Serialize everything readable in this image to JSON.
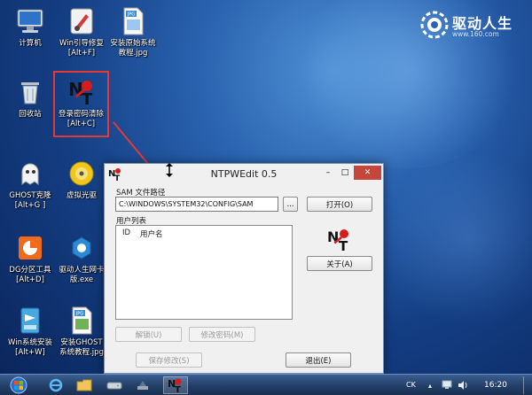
{
  "desktop": {
    "icons": [
      {
        "label1": "计算机",
        "label2": ""
      },
      {
        "label1": "Win引导修复",
        "label2": "[Alt+F]"
      },
      {
        "label1": "安装原始系统",
        "label2": "教程.jpg"
      },
      {
        "label1": "回收站",
        "label2": ""
      },
      {
        "label1": "登录密码清除",
        "label2": "[Alt+C]"
      },
      {
        "label1": "GHOST克隆",
        "label2": "[Alt+G ]"
      },
      {
        "label1": "虚拟光驱",
        "label2": ""
      },
      {
        "label1": "DG分区工具",
        "label2": "[Alt+D]"
      },
      {
        "label1": "驱动人生网卡",
        "label2": "版.exe"
      },
      {
        "label1": "Win系统安装",
        "label2": "[Alt+W]"
      },
      {
        "label1": "安装GHOST",
        "label2": "系统教程.jpg"
      }
    ],
    "jpg_badge": "JPG",
    "brand_name": "驱动人生",
    "brand_url": "www.160.com",
    "colors": {
      "selection_box": "#e53935",
      "arrow": "#e53935",
      "wallpaper": "#1c4a92"
    }
  },
  "window": {
    "title": "NTPWEdit 0.5",
    "minimize": "–",
    "maximize": "□",
    "close": "✕",
    "sam_label": "SAM 文件路径",
    "sam_path": "C:\\WINDOWS\\SYSTEM32\\CONFIG\\SAM",
    "browse": "...",
    "open": "打开(O)",
    "users_label": "用户列表",
    "col_id": "ID",
    "col_user": "用户名",
    "about": "关于(A)",
    "unlock": "解锁(U)",
    "change_pw": "修改密码(M)",
    "save": "保存修改(S)",
    "exit": "退出(E)"
  },
  "taskbar": {
    "lang": "CK",
    "time": "16:20",
    "icons": [
      "windows-start-icon",
      "ie-browser-icon",
      "folder-icon",
      "drive-icon",
      "tools-icon",
      "ntpwedit-taskbar-icon"
    ]
  }
}
